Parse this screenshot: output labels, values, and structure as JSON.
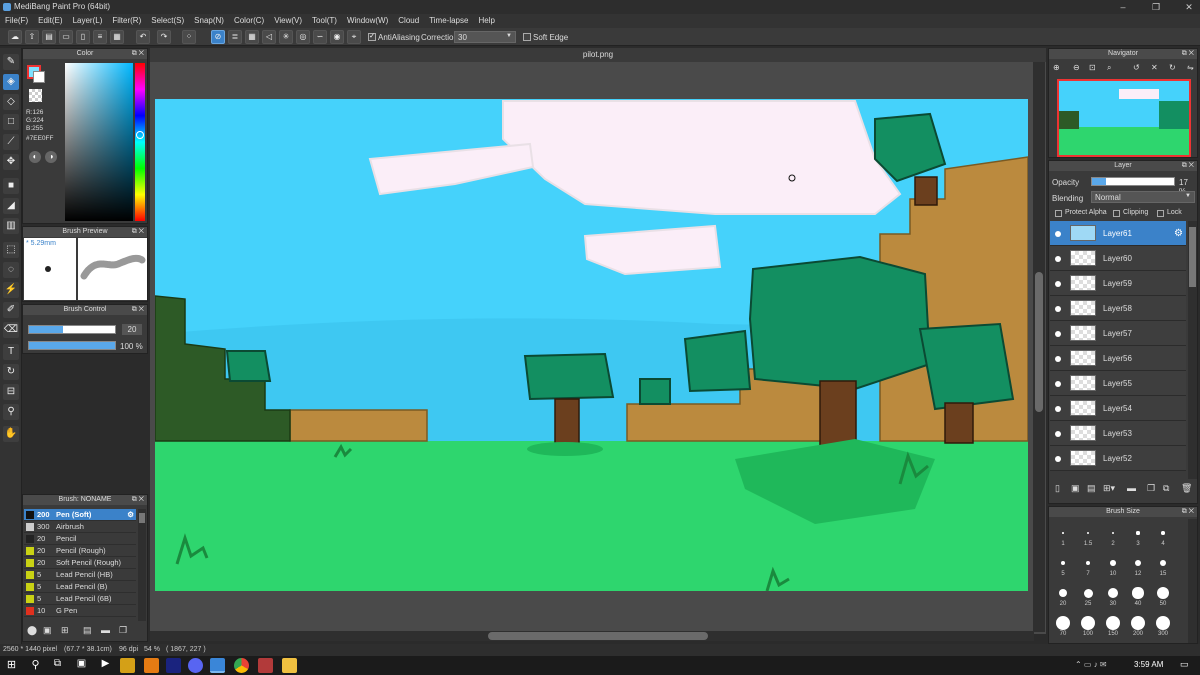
{
  "app": {
    "title": "MediBang Paint Pro (64bit)"
  },
  "menu": [
    "File(F)",
    "Edit(E)",
    "Layer(L)",
    "Filter(R)",
    "Select(S)",
    "Snap(N)",
    "Color(C)",
    "View(V)",
    "Tool(T)",
    "Window(W)",
    "Cloud",
    "Time-lapse",
    "Help"
  ],
  "toolbar": {
    "antialiasing_label": "AntiAliasing",
    "correction_label": "Correction",
    "correction_value": "30",
    "soft_edge_label": "Soft Edge"
  },
  "document": {
    "tab": "pilot.png"
  },
  "color_panel": {
    "title": "Color",
    "r": "R:126",
    "g": "G:224",
    "b": "B:255",
    "hex": "#7EE0FF",
    "fg_color": "#7EE0FF"
  },
  "brush_preview": {
    "title": "Brush Preview",
    "size": "* 5.29mm"
  },
  "brush_control": {
    "title": "Brush Control",
    "size_value": "20",
    "opacity_value": "100 %"
  },
  "brush_list": {
    "title": "Brush: NONAME",
    "items": [
      {
        "size": "200",
        "label": "Pen (Soft)",
        "color": "#111111"
      },
      {
        "size": "300",
        "label": "Airbrush",
        "color": "#cccccc"
      },
      {
        "size": "20",
        "label": "Pencil",
        "color": "#222222"
      },
      {
        "size": "20",
        "label": "Pencil (Rough)",
        "color": "#c9d214"
      },
      {
        "size": "20",
        "label": "Soft Pencil (Rough)",
        "color": "#c9d214"
      },
      {
        "size": "5",
        "label": "Lead Pencil (HB)",
        "color": "#c9d214"
      },
      {
        "size": "5",
        "label": "Lead Pencil (B)",
        "color": "#c9d214"
      },
      {
        "size": "5",
        "label": "Lead Pencil (6B)",
        "color": "#c9d214"
      },
      {
        "size": "10",
        "label": "G Pen",
        "color": "#e0301e"
      }
    ]
  },
  "navigator": {
    "title": "Navigator"
  },
  "layer_panel": {
    "title": "Layer",
    "opacity_label": "Opacity",
    "opacity_value": "17 %",
    "opacity_fraction": 0.17,
    "blending_label": "Blending",
    "blending_value": "Normal",
    "protect_alpha": "Protect Alpha",
    "clipping": "Clipping",
    "lock": "Lock",
    "layers": [
      "Layer61",
      "Layer60",
      "Layer59",
      "Layer58",
      "Layer57",
      "Layer56",
      "Layer55",
      "Layer54",
      "Layer53",
      "Layer52"
    ]
  },
  "brush_size": {
    "title": "Brush Size",
    "labels": [
      "1",
      "1.5",
      "2",
      "3",
      "4",
      "5",
      "7",
      "10",
      "12",
      "15",
      "20",
      "25",
      "30",
      "40",
      "50",
      "70",
      "100",
      "150",
      "200",
      "300"
    ]
  },
  "status": {
    "dimensions": "2560 * 1440 pixel",
    "physical": "(67.7 * 38.1cm)",
    "dpi": "96 dpi",
    "zoom": "54 %",
    "cursor": "( 1867, 227 )"
  },
  "taskbar": {
    "time": "3:59 AM"
  }
}
